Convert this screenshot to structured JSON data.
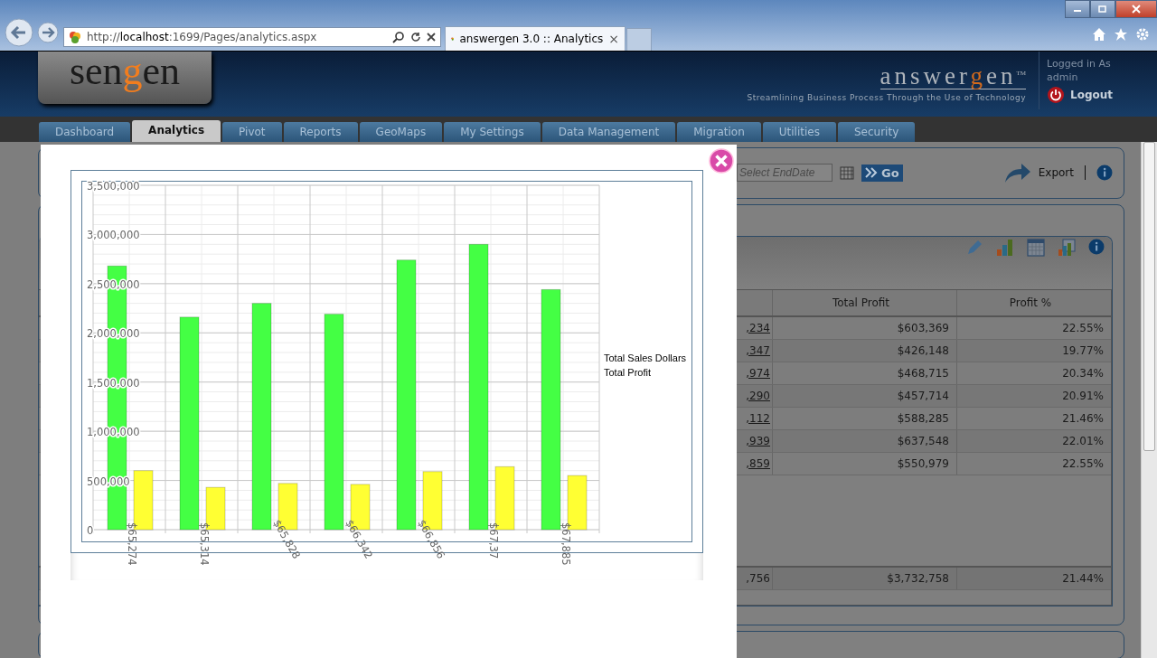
{
  "browser": {
    "address": "http://**localhost**:1699/Pages/analytics.aspx",
    "tab_title": "answergen 3.0 :: Analytics",
    "tab_close": "×"
  },
  "header": {
    "logo": [
      {
        "text": "sen",
        "accent": false
      },
      {
        "text": "g",
        "accent": true
      },
      {
        "text": "en",
        "accent": false
      }
    ],
    "brand": [
      {
        "text": "answer",
        "accent": false
      },
      {
        "text": "g",
        "accent": true
      },
      {
        "text": "en",
        "accent": false
      }
    ],
    "brand_mark": "TM",
    "tagline": "Streamlining Business Process Through the Use of Technology",
    "logged_in_label": "Logged in As",
    "user": "admin",
    "logout": "Logout"
  },
  "tabs": [
    {
      "label": "Dashboard",
      "selected": false
    },
    {
      "label": "Analytics",
      "selected": true
    },
    {
      "label": "Pivot",
      "selected": false
    },
    {
      "label": "Reports",
      "selected": false
    },
    {
      "label": "GeoMaps",
      "selected": false
    },
    {
      "label": "My Settings",
      "selected": false
    },
    {
      "label": "Data Management",
      "selected": false
    },
    {
      "label": "Migration",
      "selected": false
    },
    {
      "label": "Utilities",
      "selected": false
    },
    {
      "label": "Security",
      "selected": false
    }
  ],
  "filter": {
    "end_date": {
      "placeholder": "Select EndDate"
    },
    "go": "Go",
    "export": "Export"
  },
  "table": {
    "columns": [
      "Total Profit",
      "Profit %"
    ],
    "rows": [
      {
        "column_1": ",234",
        "profit": "$603,369",
        "pct": "22.55%"
      },
      {
        "column_1": ",347",
        "profit": "$426,148",
        "pct": "19.77%"
      },
      {
        "column_1": ",974",
        "profit": "$468,715",
        "pct": "20.34%"
      },
      {
        "column_1": ",290",
        "profit": "$457,714",
        "pct": "20.91%"
      },
      {
        "column_1": ",112",
        "profit": "$588,285",
        "pct": "21.46%"
      },
      {
        "column_1": ",939",
        "profit": "$637,548",
        "pct": "22.01%"
      },
      {
        "column_1": ",859",
        "profit": "$550,979",
        "pct": "22.55%"
      }
    ],
    "footer": {
      "column_1": ",756",
      "profit": "$3,732,758",
      "pct": "21.44%"
    }
  },
  "modal": {
    "chart_data": {
      "type": "bar",
      "categories": [
        "$65,274",
        "$65,314",
        "$65,828",
        "$66,342",
        "$66,856",
        "$67,37",
        "$67,885"
      ],
      "series": [
        {
          "name": "Total Sales Dollars",
          "color": "#44ff44",
          "values": [
            2680000,
            2160000,
            2300000,
            2190000,
            2740000,
            2900000,
            2440000
          ]
        },
        {
          "name": "Total Profit",
          "color": "#ffff33",
          "values": [
            600000,
            430000,
            470000,
            460000,
            590000,
            640000,
            550000
          ]
        }
      ],
      "grid": true,
      "ylim": [
        0,
        3500000
      ],
      "yticks": [
        {
          "value": 0,
          "label": "0"
        },
        {
          "value": 500000,
          "label": "500,000"
        },
        {
          "value": 1000000,
          "label": "1,000,000"
        },
        {
          "value": 1500000,
          "label": "1,500,000"
        },
        {
          "value": 2000000,
          "label": "2,000,000"
        },
        {
          "value": 2500000,
          "label": "2,500,000"
        },
        {
          "value": 3000000,
          "label": "3,000,000"
        },
        {
          "value": 3500000,
          "label": "3,500,000"
        }
      ]
    }
  }
}
